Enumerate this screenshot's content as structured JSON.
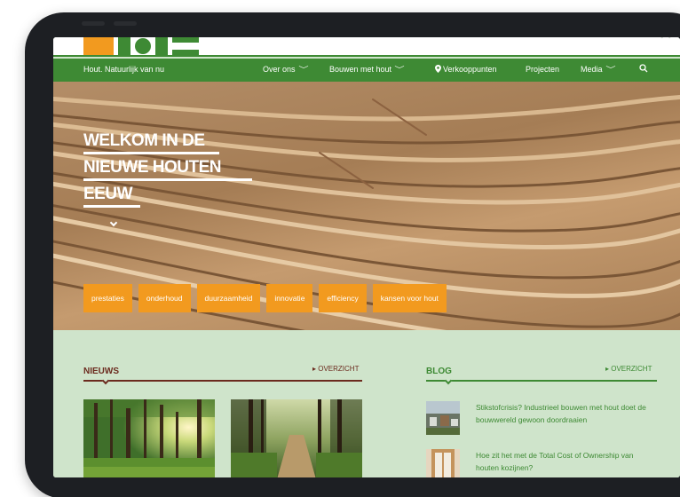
{
  "nav": {
    "tagline": "Hout. Natuurlijk van nu",
    "items": [
      {
        "label": "Over ons",
        "dropdown": true
      },
      {
        "label": "Bouwen met hout",
        "dropdown": true
      },
      {
        "label": "Verkooppunten",
        "dropdown": false,
        "icon": "location-pin-icon"
      },
      {
        "label": "Projecten",
        "dropdown": false
      },
      {
        "label": "Media",
        "dropdown": true
      }
    ],
    "search_icon": "search-icon"
  },
  "hero": {
    "headline": [
      "WELKOM IN DE",
      "NIEUWE HOUTEN",
      "EEUW"
    ],
    "tags": [
      "prestaties",
      "onderhoud",
      "duurzaamheid",
      "innovatie",
      "efficiency",
      "kansen voor hout"
    ]
  },
  "news": {
    "title": "NIEUWS",
    "more": "▸ OVERZICHT"
  },
  "blog": {
    "title": "BLOG",
    "more": "▸ OVERZICHT",
    "items": [
      {
        "title": "Stikstofcrisis? Industrieel bouwen met hout doet de bouwwereld gewoon doordraaien"
      },
      {
        "title": "Hoe zit het met de Total Cost of Ownership van houten kozijnen?"
      }
    ]
  },
  "colors": {
    "green": "#3e8a34",
    "orange": "#f29a1f",
    "mint": "#cfe4cb",
    "maroon": "#6b2a1e"
  }
}
